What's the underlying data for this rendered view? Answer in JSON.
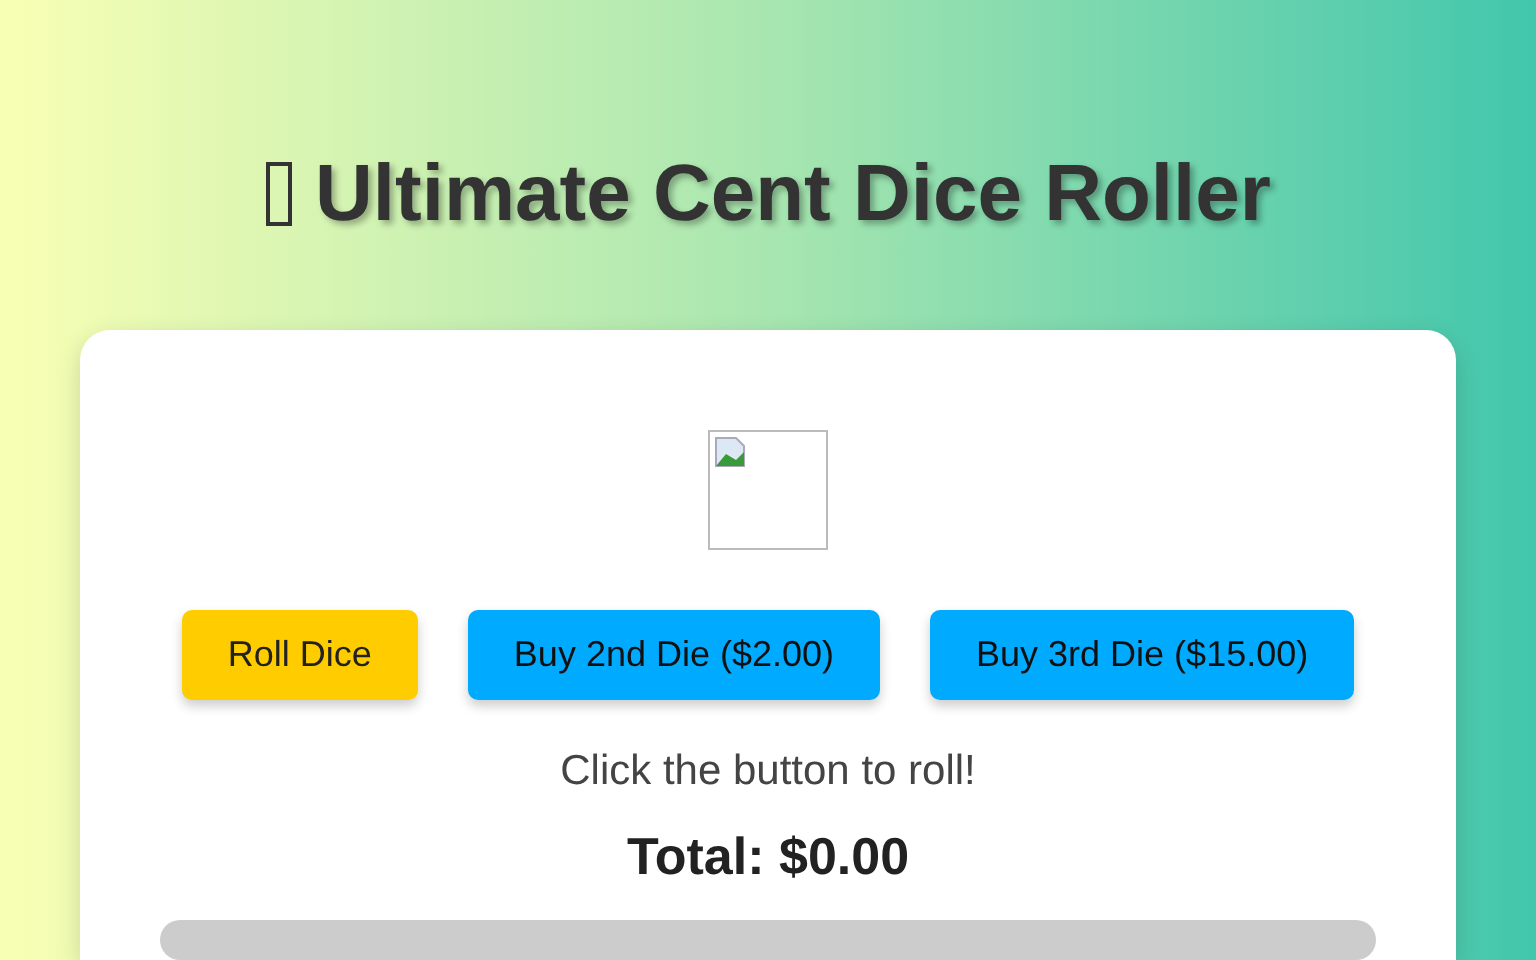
{
  "title": "Ultimate Cent Dice Roller",
  "buttons": [
    {
      "label": "Roll Dice",
      "kind": "roll"
    },
    {
      "label": "Buy 2nd Die ($2.00)",
      "kind": "buy"
    },
    {
      "label": "Buy 3rd Die ($15.00)",
      "kind": "buy"
    }
  ],
  "message": "Click the button to roll!",
  "total": "Total: $0.00",
  "progress": {
    "level": 0
  }
}
